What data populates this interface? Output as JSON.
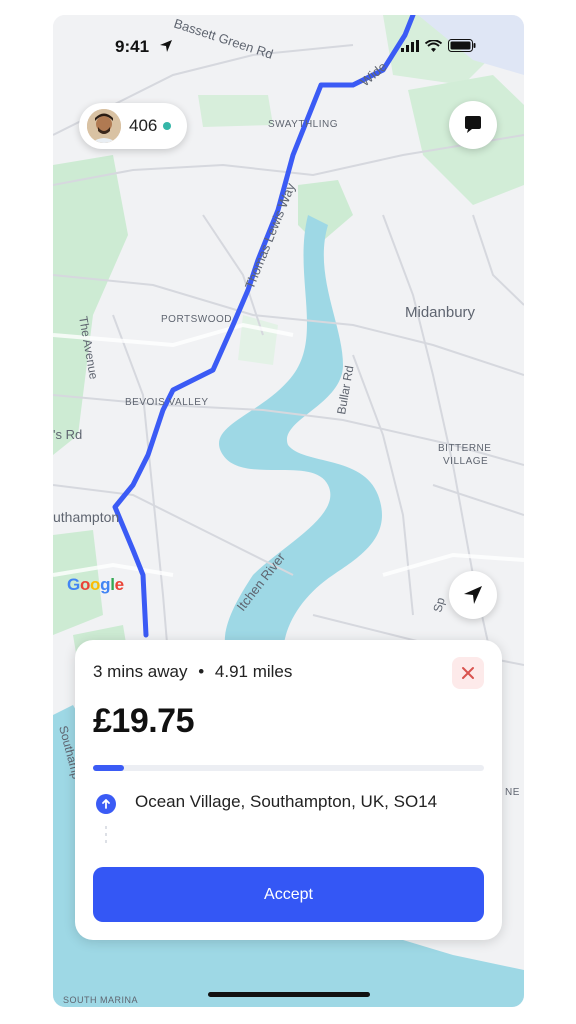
{
  "status_bar": {
    "time": "9:41"
  },
  "map": {
    "labels": {
      "bassett": "Bassett Green Rd",
      "swaythling": "SWAYTHLING",
      "widen": "Wide",
      "thomas": "Thomas Lewis Way",
      "portswood": "PORTSWOOD",
      "midanbury": "Midanbury",
      "avenue": "The Avenue",
      "bevois": "BEVOIS VALLEY",
      "bullar": "Bullar Rd",
      "bitterne": "BITTERNE",
      "bitterne2": "VILLAGE",
      "rd": "'s Rd",
      "southampton": "uthampton",
      "itchen": "Itchen River",
      "southamp": "Southamp",
      "sp": "Sp",
      "south_marina": "SOUTH MARINA",
      "ne": "NE"
    },
    "attribution": "Google"
  },
  "driver_pill": {
    "score": "406"
  },
  "offer": {
    "eta": "3 mins away",
    "separator": "•",
    "distance": "4.91 miles",
    "price": "£19.75",
    "progress_fraction": 0.08,
    "destination": "Ocean Village, Southampton, UK, SO14",
    "accept_label": "Accept"
  },
  "colors": {
    "accent": "#3457f5",
    "route": "#3b5bf5",
    "water": "#9ed8e5",
    "park": "#cdebd3"
  }
}
